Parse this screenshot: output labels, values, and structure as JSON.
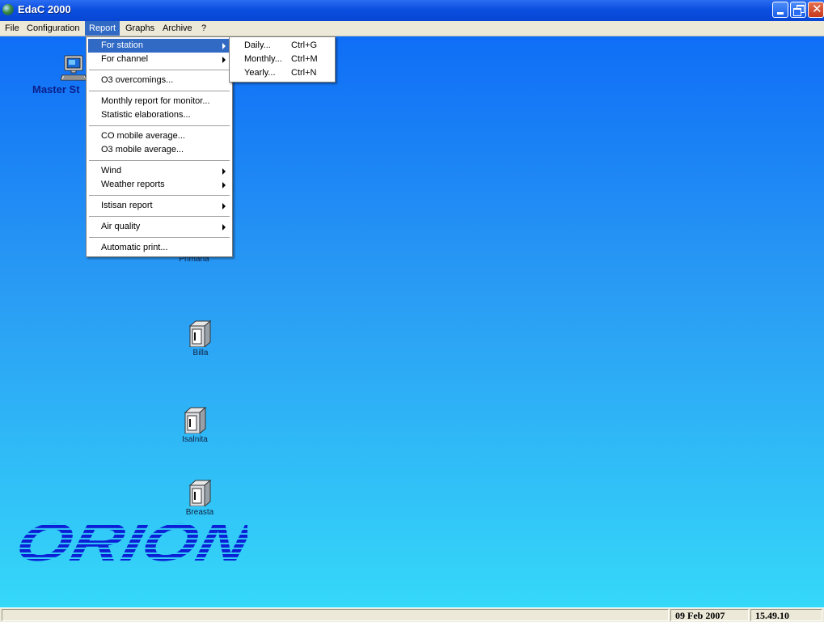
{
  "window": {
    "title": "EdaC 2000"
  },
  "menubar": [
    {
      "label": "File"
    },
    {
      "label": "Configuration"
    },
    {
      "label": "Report"
    },
    {
      "label": "Graphs"
    },
    {
      "label": "Archive"
    },
    {
      "label": "?"
    }
  ],
  "report_menu": [
    {
      "label": "For station",
      "submenu": true
    },
    {
      "label": "For channel",
      "submenu": true
    },
    {
      "label": "O3 overcomings..."
    },
    {
      "label": "Monthly report for monitor..."
    },
    {
      "label": "Statistic elaborations..."
    },
    {
      "label": "CO mobile average..."
    },
    {
      "label": "O3 mobile average..."
    },
    {
      "label": "Wind",
      "submenu": true
    },
    {
      "label": "Weather reports",
      "submenu": true
    },
    {
      "label": "Istisan report",
      "submenu": true
    },
    {
      "label": "Air quality",
      "submenu": true
    },
    {
      "label": "Automatic print..."
    }
  ],
  "station_submenu": [
    {
      "label": "Daily...",
      "shortcut": "Ctrl+G"
    },
    {
      "label": "Monthly...",
      "shortcut": "Ctrl+M"
    },
    {
      "label": "Yearly...",
      "shortcut": "Ctrl+N"
    }
  ],
  "desktop": {
    "master_label": "Master St",
    "stations": [
      {
        "label": "Primaria"
      },
      {
        "label": "Billa"
      },
      {
        "label": "Isalnita"
      },
      {
        "label": "Breasta"
      }
    ],
    "logo_text": "ORION"
  },
  "statusbar": {
    "left": "",
    "date": "09 Feb 2007",
    "time": "15.49.10"
  },
  "colors": {
    "menu_highlight": "#316ac5",
    "logo": "#0b1fd6"
  }
}
